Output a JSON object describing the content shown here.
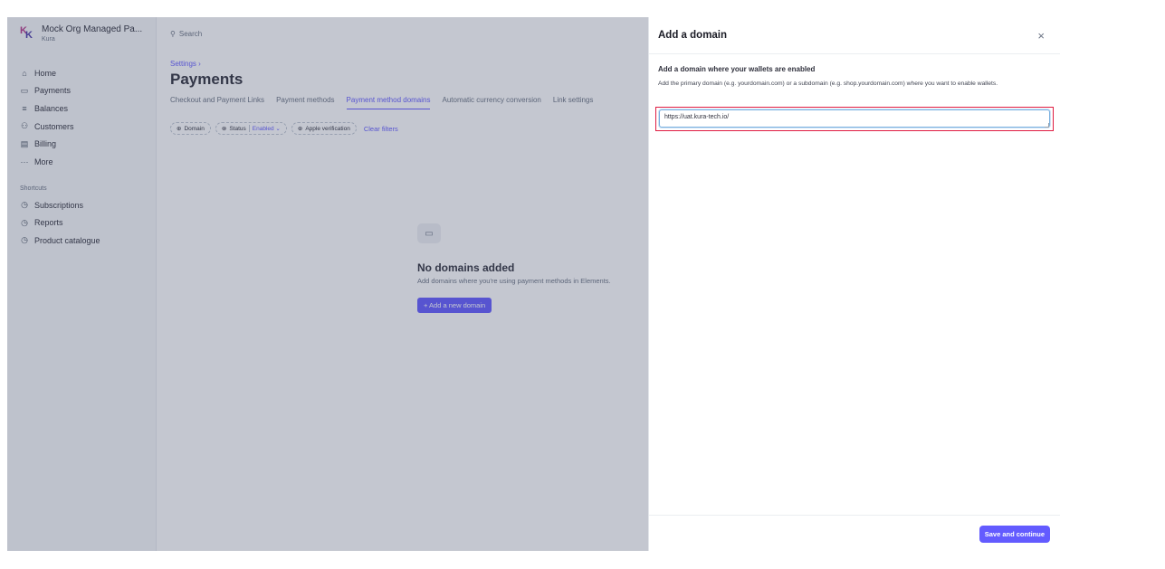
{
  "org": {
    "name": "Mock Org Managed Pa...",
    "sub": "Kura"
  },
  "sidebar": {
    "items": [
      {
        "icon": "home-icon",
        "glyph": "⌂",
        "label": "Home"
      },
      {
        "icon": "payments-icon",
        "glyph": "▭",
        "label": "Payments"
      },
      {
        "icon": "balances-icon",
        "glyph": "≡",
        "label": "Balances"
      },
      {
        "icon": "customers-icon",
        "glyph": "⚇",
        "label": "Customers"
      },
      {
        "icon": "billing-icon",
        "glyph": "▤",
        "label": "Billing"
      },
      {
        "icon": "more-icon",
        "glyph": "···",
        "label": "More"
      }
    ],
    "shortcuts_title": "Shortcuts",
    "shortcuts": [
      {
        "icon": "clock-icon",
        "glyph": "◷",
        "label": "Subscriptions"
      },
      {
        "icon": "clock-icon",
        "glyph": "◷",
        "label": "Reports"
      },
      {
        "icon": "clock-icon",
        "glyph": "◷",
        "label": "Product catalogue"
      }
    ]
  },
  "main": {
    "search_placeholder": "Search",
    "breadcrumb": "Settings ›",
    "title": "Payments",
    "tabs": [
      {
        "label": "Checkout and Payment Links",
        "active": false
      },
      {
        "label": "Payment methods",
        "active": false
      },
      {
        "label": "Payment method domains",
        "active": true
      },
      {
        "label": "Automatic currency conversion",
        "active": false
      },
      {
        "label": "Link settings",
        "active": false
      }
    ],
    "filters": {
      "domain": "Domain",
      "status": "Status",
      "status_value": "Enabled ⌄",
      "apple": "Apple verification",
      "clear": "Clear filters"
    },
    "empty": {
      "title": "No domains added",
      "description": "Add domains where you're using payment methods in Elements.",
      "button": "+ Add a new domain"
    }
  },
  "drawer": {
    "title": "Add a domain",
    "close": "×",
    "heading": "Add a domain where your wallets are enabled",
    "description": "Add the primary domain (e.g. yourdomain.com) or a subdomain (e.g. shop.yourdomain.com) where you want to enable wallets.",
    "input_value": "https://uat.kura-tech.io/",
    "save_label": "Save and continue"
  },
  "colors": {
    "accent": "#635bff",
    "highlight": "#df1b41"
  }
}
